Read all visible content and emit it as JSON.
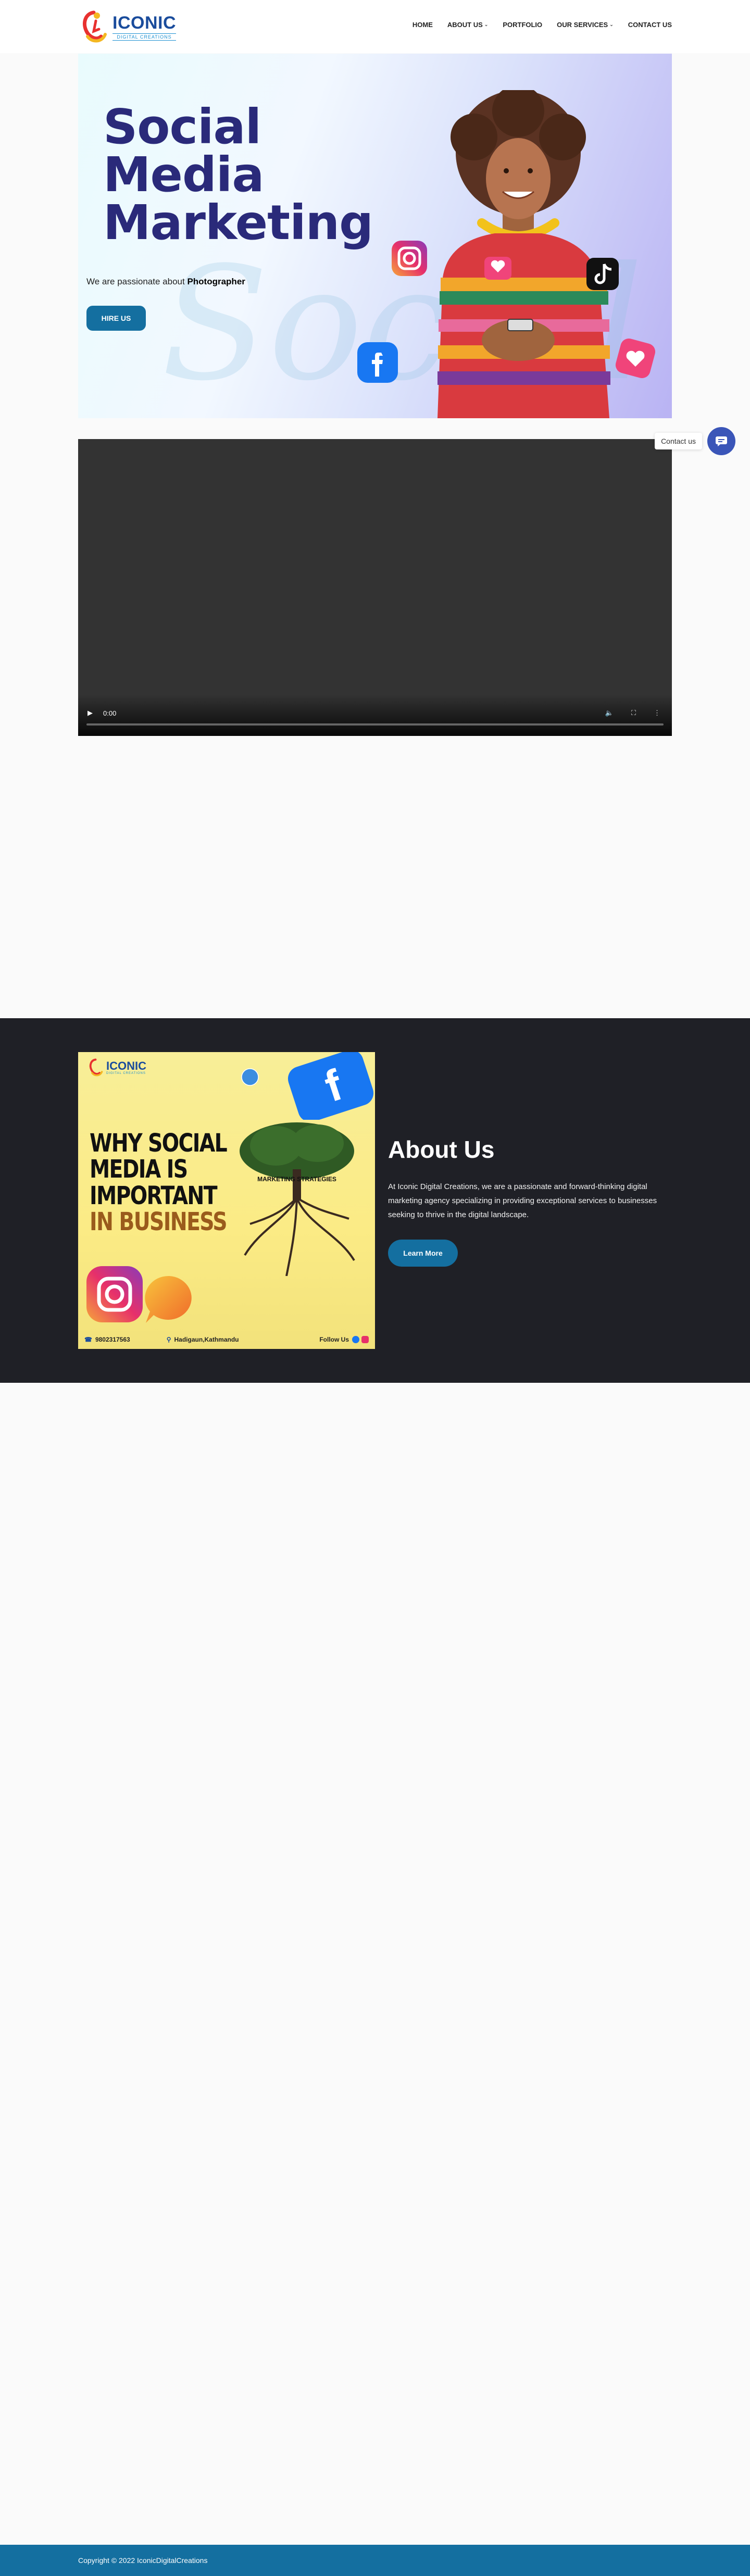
{
  "header": {
    "logo": {
      "name": "ICONIC",
      "sub": "DIGITAL CREATIONS"
    },
    "nav": [
      {
        "label": "HOME",
        "dropdown": false
      },
      {
        "label": "ABOUT US",
        "dropdown": true
      },
      {
        "label": "PORTFOLIO",
        "dropdown": false
      },
      {
        "label": "OUR SERVICES",
        "dropdown": true
      },
      {
        "label": "CONTACT US",
        "dropdown": false
      }
    ]
  },
  "hero": {
    "title_line1": "Social",
    "title_line2": "Media",
    "title_line3": "Marketing",
    "sub_prefix": "We are passionate about ",
    "sub_bold": "Photographer",
    "button": "HIRE US",
    "background_script": "Social"
  },
  "video": {
    "time": "0:00"
  },
  "contact_float": {
    "label": "Contact us"
  },
  "about": {
    "image": {
      "logo_name": "ICONIC",
      "logo_sub": "DIGITAL CREATIONS",
      "headline_1": "WHY SOCIAL",
      "headline_2": "MEDIA IS",
      "headline_3": "IMPORTANT",
      "headline_4": "IN BUSINESS",
      "tree_label": "MARKETING STRATEGIES",
      "phone": "9802317563",
      "location": "Hadigaun,Kathmandu",
      "follow": "Follow Us"
    },
    "title": "About Us",
    "text": "At Iconic Digital Creations, we are a passionate and forward-thinking digital marketing agency specializing in providing exceptional services to businesses seeking to thrive in the digital landscape.",
    "button": "Learn More"
  },
  "footer": {
    "copyright": "Copyright © 2022 IconicDigitalCreations"
  },
  "colors": {
    "brand_blue": "#146fa0",
    "hero_title": "#2a2a7a",
    "dark_section": "#1f2026",
    "contact_blue": "#3a55b8"
  }
}
